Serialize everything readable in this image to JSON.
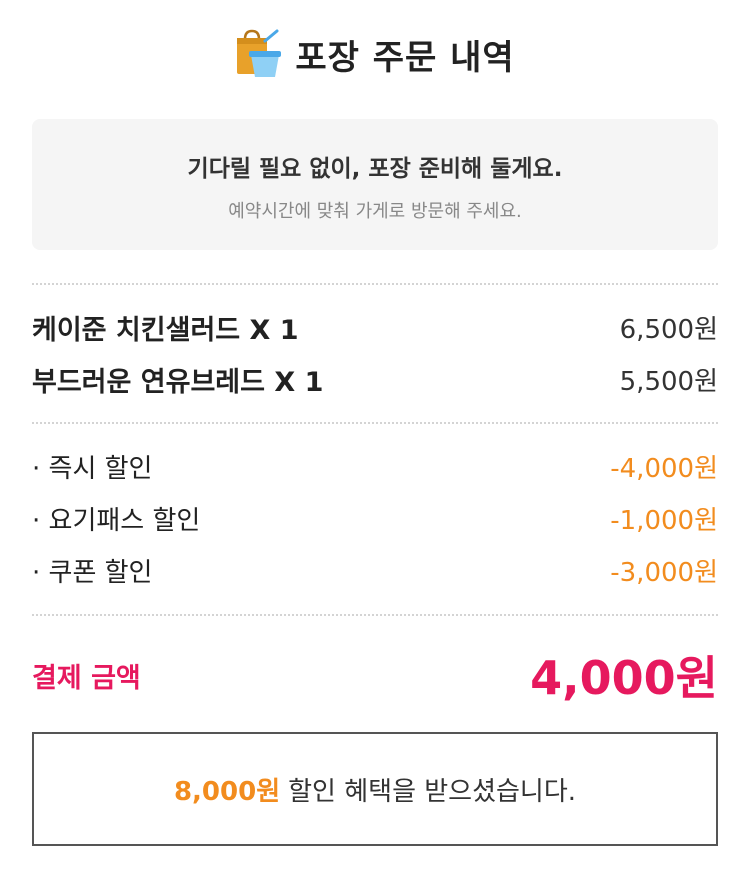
{
  "header": {
    "icon": "takeout-bag-icon",
    "title": "포장 주문 내역"
  },
  "notice": {
    "title": "기다릴 필요 없이, 포장 준비해 둘게요.",
    "subtitle": "예약시간에 맞춰 가게로 방문해 주세요."
  },
  "items": [
    {
      "name": "케이준 치킨샐러드 X 1",
      "price": "6,500원"
    },
    {
      "name": "부드러운 연유브레드 X 1",
      "price": "5,500원"
    }
  ],
  "discounts": [
    {
      "name": "· 즉시 할인",
      "amount": "-4,000원"
    },
    {
      "name": "· 요기패스 할인",
      "amount": "-1,000원"
    },
    {
      "name": "· 쿠폰 할인",
      "amount": "-3,000원"
    }
  ],
  "total": {
    "label": "결제 금액",
    "value": "4,000원"
  },
  "benefit": {
    "amount": "8,000원",
    "text": "할인 혜택을 받으셨습니다."
  },
  "colors": {
    "accent_orange": "#f28c1e",
    "accent_pink": "#e6195e",
    "bag_icon": "#e8a12a",
    "cup_icon": "#4aa8e8"
  }
}
